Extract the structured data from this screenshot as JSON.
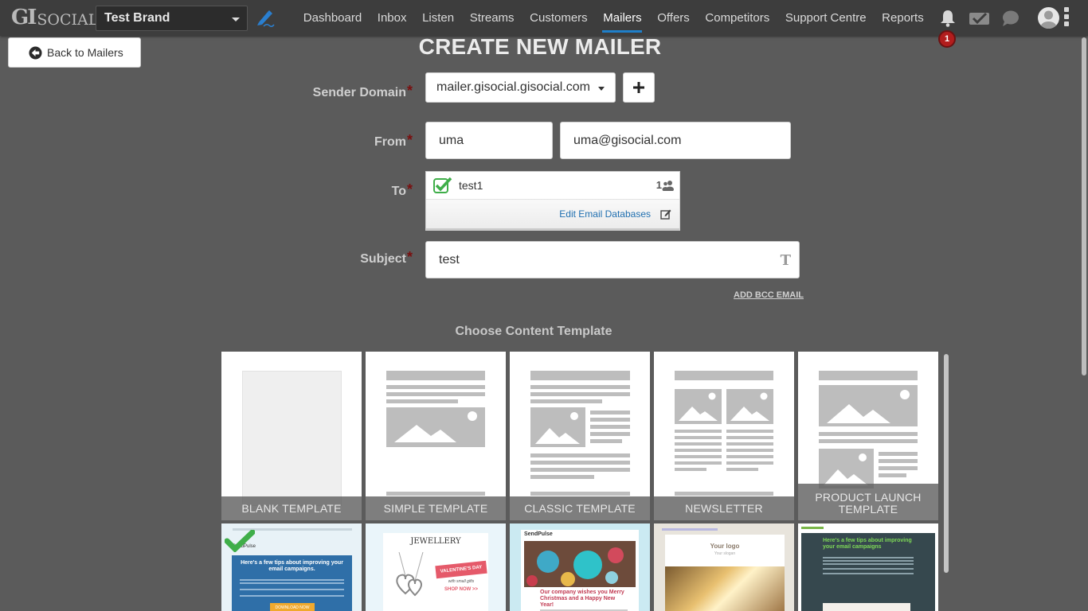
{
  "app": {
    "logo_primary": "GI",
    "logo_secondary": "SOCIAL",
    "brand": "Test Brand"
  },
  "nav": {
    "items": [
      {
        "label": "Dashboard"
      },
      {
        "label": "Inbox"
      },
      {
        "label": "Listen"
      },
      {
        "label": "Streams"
      },
      {
        "label": "Customers"
      },
      {
        "label": "Mailers",
        "active": true
      },
      {
        "label": "Offers"
      },
      {
        "label": "Competitors"
      },
      {
        "label": "Support Centre"
      },
      {
        "label": "Reports"
      }
    ],
    "notification_count": "1"
  },
  "page": {
    "back_label": "Back to Mailers",
    "title": "CREATE NEW MAILER"
  },
  "form": {
    "sender_domain_label": "Sender Domain",
    "sender_domain_value": "mailer.gisocial.gisocial.com",
    "add_domain_label": "+",
    "from_label": "From",
    "from_name": "uma",
    "from_email": "uma@gisocial.com",
    "to_label": "To",
    "to_list": {
      "name": "test1",
      "count": "1",
      "checked": true
    },
    "edit_db_label": "Edit Email Databases",
    "subject_label": "Subject",
    "subject_value": "test",
    "subject_format_icon": "T",
    "required_mark": "*",
    "bcc_label": "ADD BCC EMAIL"
  },
  "templates": {
    "section_title": "Choose Content Template",
    "items": [
      {
        "label": "BLANK TEMPLATE"
      },
      {
        "label": "SIMPLE TEMPLATE"
      },
      {
        "label": "CLASSIC TEMPLATE"
      },
      {
        "label": "NEWSLETTER"
      },
      {
        "label": "PRODUCT LAUNCH TEMPLATE"
      }
    ],
    "previews": [
      {
        "heading": "Here's a few tips about improving your email campaigns.",
        "button": "DOWNLOAD NOW",
        "brand": "SendPulse",
        "selected": true
      },
      {
        "heading": "JEWELLERY",
        "subheading": "VALENTINE'S DAY",
        "tagline": "with small gifts",
        "cta": "SHOP NOW >>"
      },
      {
        "brand": "SendPulse",
        "heading": "Our company wishes you Merry Christmas and a Happy New Year!"
      },
      {
        "heading": "Your logo",
        "subheading": "Your slogan"
      },
      {
        "heading": "Here's a few tips about improving your email campaigns"
      }
    ]
  },
  "colors": {
    "background": "#5b5b5b",
    "navbar": "#3d3d3d",
    "accent": "#1f7fc9",
    "badge": "#b21d1d",
    "required": "#7a0e0e",
    "check": "#3fae49"
  }
}
